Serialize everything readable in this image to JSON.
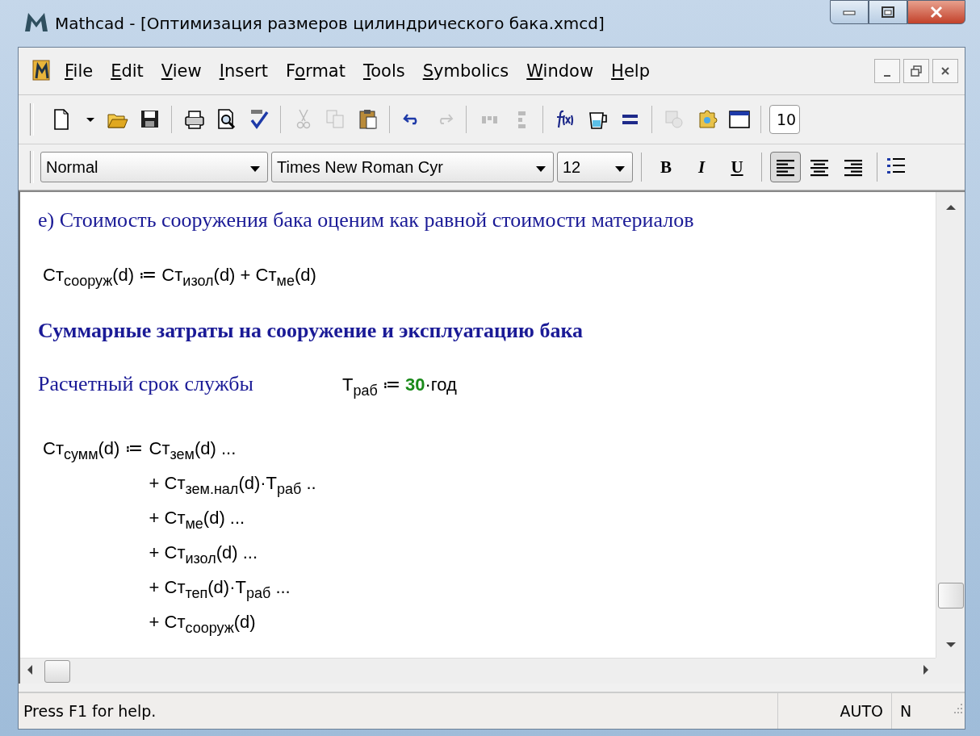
{
  "window": {
    "title": "Mathcad - [Оптимизация размеров цилиндрического бака.xmcd]"
  },
  "menu": [
    {
      "key": "F",
      "rest": "ile"
    },
    {
      "key": "E",
      "rest": "dit"
    },
    {
      "key": "V",
      "rest": "iew"
    },
    {
      "key": "I",
      "rest": "nsert"
    },
    {
      "pre": "F",
      "key": "o",
      "rest": "rmat"
    },
    {
      "key": "T",
      "rest": "ools"
    },
    {
      "key": "S",
      "rest": "ymbolics"
    },
    {
      "key": "W",
      "rest": "indow"
    },
    {
      "key": "H",
      "rest": "elp"
    }
  ],
  "toolbar": {
    "groups": [
      [
        {
          "kind": "new",
          "disabled": false
        },
        {
          "kind": "caret",
          "disabled": false
        },
        {
          "kind": "open",
          "disabled": false
        },
        {
          "kind": "save",
          "disabled": false
        }
      ],
      [
        {
          "kind": "print",
          "disabled": false
        },
        {
          "kind": "preview",
          "disabled": false
        },
        {
          "kind": "spell",
          "disabled": false
        }
      ],
      [
        {
          "kind": "cut",
          "disabled": true
        },
        {
          "kind": "copy",
          "disabled": true
        },
        {
          "kind": "paste",
          "disabled": false
        }
      ],
      [
        {
          "kind": "undo",
          "disabled": false
        },
        {
          "kind": "redo",
          "disabled": true
        }
      ],
      [
        {
          "kind": "align-across",
          "disabled": true
        },
        {
          "kind": "align-down",
          "disabled": true
        }
      ],
      [
        {
          "kind": "function",
          "disabled": false
        },
        {
          "kind": "units",
          "disabled": false
        },
        {
          "kind": "equals",
          "disabled": false
        }
      ],
      [
        {
          "kind": "component",
          "disabled": true
        },
        {
          "kind": "puzzle",
          "disabled": false
        },
        {
          "kind": "window",
          "disabled": false
        }
      ]
    ],
    "zoom": "10"
  },
  "formatbar": {
    "style": "Normal",
    "font": "Times New Roman Cyr",
    "size": "12",
    "styles": [
      {
        "label": "B",
        "kind": "bold"
      },
      {
        "label": "I",
        "kind": "italic"
      },
      {
        "label": "U",
        "kind": "underline"
      }
    ],
    "align": [
      {
        "kind": "left",
        "selected": true
      },
      {
        "kind": "center",
        "selected": false
      },
      {
        "kind": "right",
        "selected": false
      }
    ]
  },
  "document": {
    "blocks": [
      {
        "kind": "text",
        "text": "е) Стоимость сооружения бака оценим как равной стоимости материалов"
      },
      {
        "kind": "math",
        "text": "Ст$_{сооруж}$(d) ≔ Ст$_{изол}$(d) + Ст$_{ме}$(d)"
      },
      {
        "kind": "heading",
        "text": "Суммарные затраты на сооружение и эксплуатацию бака"
      },
      {
        "kind": "definition",
        "label": "Расчетный срок службы",
        "lhs": "T$_{раб}$ ≔",
        "number": "30",
        "unit": "·год"
      },
      {
        "kind": "sum",
        "lhs": "Ст$_{сумм}$(d) ≔",
        "lines": [
          "Ст$_{зем}$(d) ...",
          "+ Ст$_{зем.нал}$(d)·T$_{раб}$ ..",
          "+ Ст$_{ме}$(d) ...",
          "+ Ст$_{изол}$(d) ...",
          "+ Ст$_{теп}$(d)·T$_{раб}$ ...",
          "+ Ст$_{сооруж}$(d)"
        ]
      }
    ]
  },
  "status_bar": {
    "message": "Press F1 for help.",
    "mode": "AUTO",
    "num": "N"
  }
}
